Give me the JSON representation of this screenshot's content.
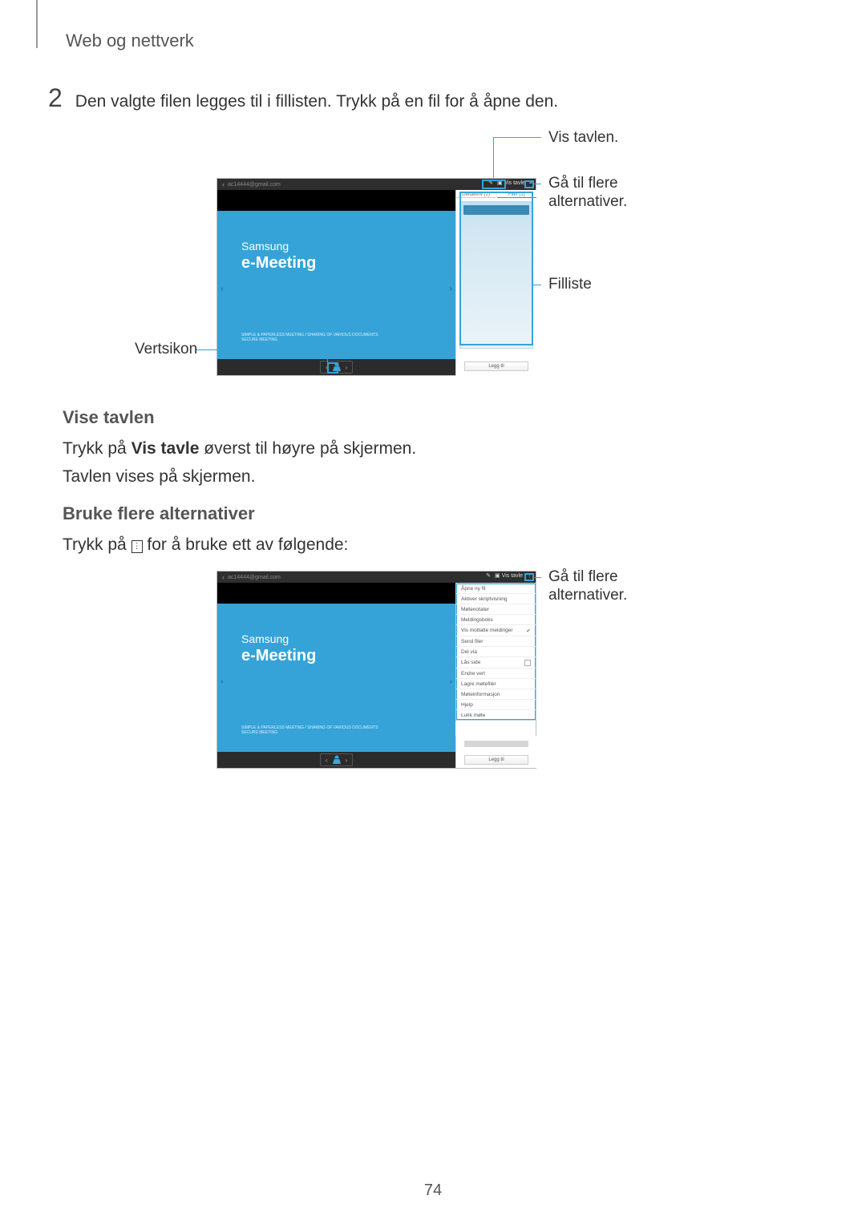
{
  "header": {
    "section": "Web og nettverk"
  },
  "step": {
    "number": "2",
    "text": "Den valgte filen legges til i fillisten. Trykk på en fil for å åpne den."
  },
  "callouts": {
    "fig1": {
      "vertsikon": "Vertsikon",
      "vis_tavlen": "Vis tavlen.",
      "gatil1": "Gå til flere",
      "gatil2": "alternativer.",
      "filliste": "Filliste"
    },
    "fig2": {
      "gatil1": "Gå til flere",
      "gatil2": "alternativer."
    }
  },
  "screenshot": {
    "email": "ac14444@gmail.com",
    "vis_tavle": "Vis tavle",
    "brand": "Samsung",
    "product": "e-Meeting",
    "subtext1": "SIMPLE & PAPERLESS MEETING / SHARING OF VARIOUS DOCUMENTS",
    "subtext2": "SECURE MEETING",
    "tabs": {
      "participants": "Deltakere (2)",
      "files": "Filer (1)"
    },
    "leggtil": "Legg til",
    "menu": [
      "Åpne ny fil",
      "Aktiver skriptvisning",
      "Møtenotater",
      "Meldingsboks",
      "Vis mottatte meldinger",
      "Send filer",
      "Del via",
      "Lås side",
      "Endre vert",
      "Lagre møtefiler",
      "Møteinformasjon",
      "Hjelp",
      "Lukk møte"
    ]
  },
  "headings": {
    "vise_tavlen": "Vise tavlen",
    "bruke_flere": "Bruke flere alternativer"
  },
  "body": {
    "p1_pre": "Trykk på ",
    "p1_bold": "Vis tavle",
    "p1_post": " øverst til høyre på skjermen.",
    "p2": "Tavlen vises på skjermen.",
    "p3_pre": "Trykk på ",
    "p3_post": " for å bruke ett av følgende:"
  },
  "page": "74"
}
